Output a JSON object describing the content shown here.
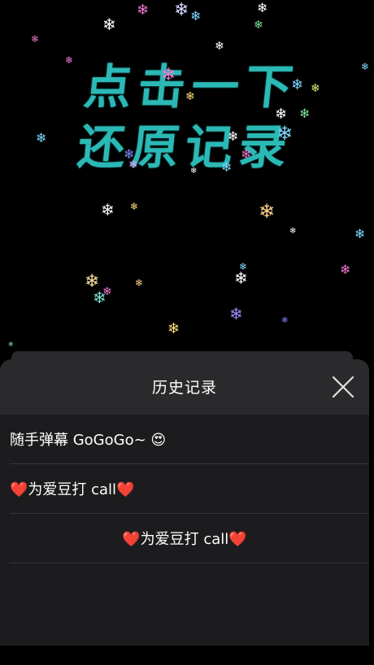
{
  "overlay": {
    "headline_line1": "点击一下",
    "headline_line2": "还原记录"
  },
  "sheet": {
    "title": "历史记录",
    "close_icon": "close-x-icon",
    "items": [
      {
        "text": "随手弹幕 GoGoGo~ 😍"
      },
      {
        "text": "❤️为爱豆打 call❤️"
      },
      {
        "text": "❤️为爱豆打 call❤️"
      }
    ]
  },
  "colors": {
    "background": "#000000",
    "headline": "#2bb9b6",
    "sheet_bg": "#1c1c1e",
    "sheet_header_bg": "#2a2a2c",
    "divider": "#34343a",
    "text": "#ffffff"
  }
}
